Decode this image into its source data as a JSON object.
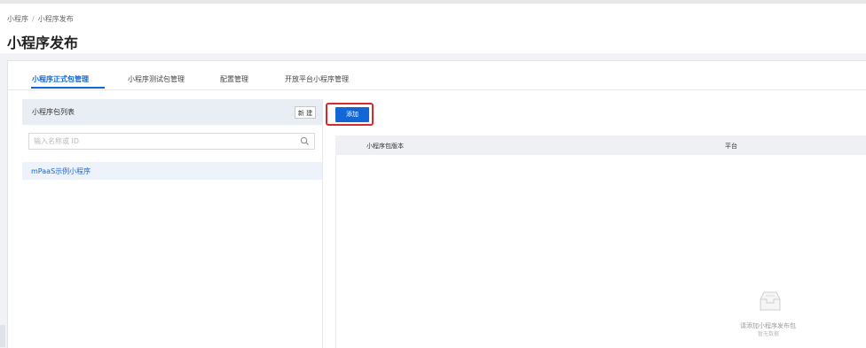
{
  "breadcrumb": {
    "items": [
      "小程序",
      "小程序发布"
    ],
    "separator": "/"
  },
  "page": {
    "title": "小程序发布"
  },
  "tabs": [
    {
      "label": "小程序正式包管理",
      "active": true
    },
    {
      "label": "小程序测试包管理",
      "active": false
    },
    {
      "label": "配置管理",
      "active": false
    },
    {
      "label": "开放平台小程序管理",
      "active": false
    }
  ],
  "left_panel": {
    "title": "小程序包列表",
    "new_button": "新 建",
    "search": {
      "placeholder": "输入名称或 ID",
      "value": "",
      "icon": "search-icon"
    },
    "items": [
      {
        "label": "mPaaS示例小程序",
        "selected": true
      }
    ]
  },
  "right_panel": {
    "add_button": "添加",
    "table": {
      "columns": [
        "小程序包版本",
        "平台"
      ],
      "rows": []
    },
    "empty": {
      "message": "请添加小程序发布包",
      "sub": "暂无数据",
      "icon": "empty-inbox-icon"
    }
  },
  "colors": {
    "accent": "#1366d6",
    "highlight_border": "#d92b2b",
    "panel_header": "#e9eef5"
  }
}
